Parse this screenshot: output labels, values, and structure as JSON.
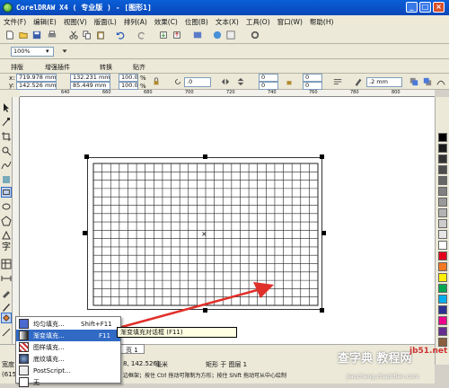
{
  "titlebar": {
    "title": "CorelDRAW X4 ( 专业版 ) - [图形1]"
  },
  "menu": [
    "文件(F)",
    "编辑(E)",
    "视图(V)",
    "版面(L)",
    "排列(A)",
    "效果(C)",
    "位图(B)",
    "文本(X)",
    "工具(O)",
    "窗口(W)",
    "帮助(H)"
  ],
  "standard_toolbar": {
    "zoom_value": "100%"
  },
  "plugin_bar": {
    "items": [
      "排版",
      "增强插件",
      "转换",
      "贴齐"
    ]
  },
  "property_bar": {
    "x_label": "x:",
    "x_value": "719.978 mm",
    "y_label": "y:",
    "y_value": "142.526 mm",
    "width_value": "132.231 mm",
    "height_value": "85.449 mm",
    "scale_x": "100.0",
    "scale_y": "100.0",
    "pct": "%",
    "rotation": ".0",
    "corner1": "0",
    "corner2": "0",
    "corner3": "0",
    "corner4": "0",
    "outline_width": ".2 mm"
  },
  "ruler": {
    "top_ticks": [
      "640",
      "660",
      "680",
      "700",
      "720",
      "740",
      "760",
      "780",
      "800"
    ]
  },
  "flyout": {
    "items": [
      {
        "label": "均匀填充...",
        "shortcut": "Shift+F11"
      },
      {
        "label": "渐变填充...",
        "shortcut": "F11"
      },
      {
        "label": "图样填充..."
      },
      {
        "label": "底纹填充..."
      },
      {
        "label": "PostScript..."
      },
      {
        "label": "无"
      }
    ]
  },
  "tooltip": {
    "text": "渐变填充对话框 (F11)"
  },
  "status": {
    "left_label": "宽度",
    "left_value": "(615",
    "coords": "8, 142.526)",
    "units": "毫米",
    "object_info": "矩形 于 图层 1",
    "hint": "边框架；按住 Ctrl 拖动可限制为方形；按住 Shift 拖动可从中心绘制",
    "page_tab": "页 1"
  },
  "watermark": {
    "line1": "查字典 教程网",
    "line2": "jb51.net",
    "line3": "jiaocheng.chazidian.com"
  },
  "colors": {
    "titlebar": "#0a5fd8",
    "accent_arrow": "#e0302a",
    "highlight": "#316ac5"
  }
}
